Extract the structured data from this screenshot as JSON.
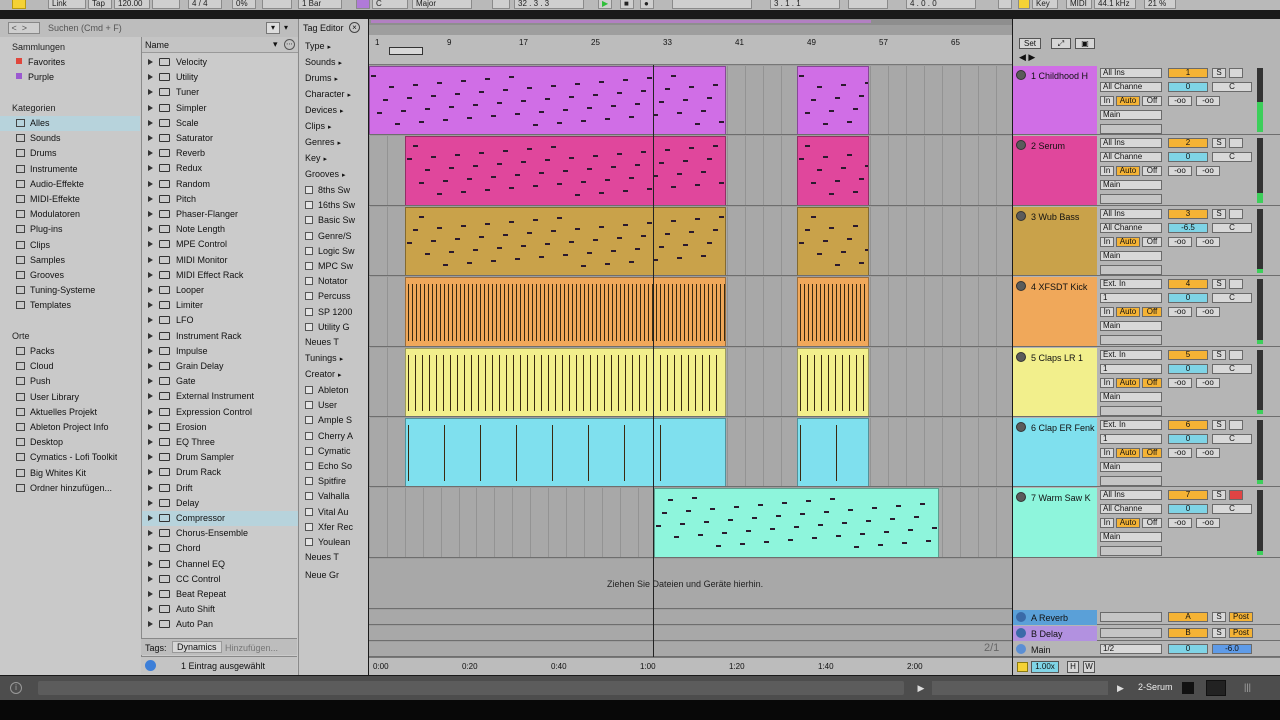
{
  "topbar": {
    "link": "Link",
    "tap": "Tap",
    "tempo": "120.00",
    "signature": "4 / 4",
    "groove_pct": "0%",
    "quantize": "1 Bar",
    "key_root": "C",
    "scale": "Major",
    "position": "32 . 3 . 3",
    "loop_start": "3 . 1 . 1",
    "loop_length": "4 . 0 . 0",
    "key_label": "Key",
    "midi_label": "MIDI",
    "sample_rate": "44.1 kHz",
    "cpu": "21 %"
  },
  "browser": {
    "search_placeholder": "Suchen (Cmd + F)",
    "collections_title": "Sammlungen",
    "collections": [
      {
        "label": "Favorites",
        "color": "#e0463c"
      },
      {
        "label": "Purple",
        "color": "#9b59d0"
      }
    ],
    "categories_title": "Kategorien",
    "categories": [
      "Alles",
      "Sounds",
      "Drums",
      "Instrumente",
      "Audio-Effekte",
      "MIDI-Effekte",
      "Modulatoren",
      "Plug-ins",
      "Clips",
      "Samples",
      "Grooves",
      "Tuning-Systeme",
      "Templates"
    ],
    "places_title": "Orte",
    "places": [
      "Packs",
      "Cloud",
      "Push",
      "User Library",
      "Aktuelles Projekt",
      "Ableton Project Info",
      "Desktop",
      "Cymatics - Lofi Toolkit",
      "Big Whites Kit",
      "Ordner hinzufügen..."
    ],
    "column_name": "Name",
    "items": [
      "Velocity",
      "Utility",
      "Tuner",
      "Simpler",
      "Scale",
      "Saturator",
      "Reverb",
      "Redux",
      "Random",
      "Pitch",
      "Phaser-Flanger",
      "Note Length",
      "MPE Control",
      "MIDI Monitor",
      "MIDI Effect Rack",
      "Looper",
      "Limiter",
      "LFO",
      "Instrument Rack",
      "Impulse",
      "Grain Delay",
      "Gate",
      "External Instrument",
      "Expression Control",
      "Erosion",
      "EQ Three",
      "Drum Sampler",
      "Drum Rack",
      "Drift",
      "Delay",
      "Compressor",
      "Chorus-Ensemble",
      "Chord",
      "Channel EQ",
      "CC Control",
      "Beat Repeat",
      "Auto Shift",
      "Auto Pan"
    ],
    "selected_item": "Compressor",
    "tags_label": "Tags:",
    "tag_dynamics": "Dynamics",
    "tag_add": "Hinzufügen...",
    "status": "1 Eintrag ausgewählt",
    "tag_editor": "Tag Editor",
    "tag_groups": [
      "Type",
      "Sounds",
      "Drums",
      "Character",
      "Devices",
      "Clips",
      "Genres",
      "Key",
      "Grooves"
    ],
    "grooves": [
      "8ths Sw",
      "16ths Sw",
      "Basic Sw",
      "Genre/S",
      "Logic Sw",
      "MPC Sw",
      "Notator",
      "Percuss",
      "SP 1200",
      "Utility G"
    ],
    "new_tag": "Neues T",
    "tunings": "Tunings",
    "creator": "Creator",
    "creators": [
      "Ableton",
      "User",
      "Ample S",
      "Cherry A",
      "Cymatic",
      "Echo So",
      "Spitfire",
      "Valhalla",
      "Vital Au",
      "Xfer Rec",
      "Youlean"
    ],
    "new_tag2": "Neues T",
    "new_group": "Neue Gr"
  },
  "arrangement": {
    "bars": [
      "1",
      "9",
      "17",
      "25",
      "33",
      "41",
      "49",
      "57",
      "65"
    ],
    "times": [
      "0:00",
      "0:20",
      "0:40",
      "1:00",
      "1:20",
      "1:40",
      "2:00"
    ],
    "drop_hint": "Ziehen Sie Dateien und Geräte hierhin.",
    "zoom": "2/1"
  },
  "tracks": [
    {
      "name": "1 Childhood H",
      "color": "#d06ee6",
      "input": "All Ins",
      "channel": "All Channe",
      "num": "1",
      "vol": "0",
      "pan": "C",
      "send_a": "-oo",
      "send_b": "-oo",
      "monitor": "Main"
    },
    {
      "name": "2 Serum",
      "color": "#e0479c",
      "input": "All Ins",
      "channel": "All Channe",
      "num": "2",
      "vol": "0",
      "pan": "C",
      "send_a": "-oo",
      "send_b": "-oo",
      "monitor": "Main"
    },
    {
      "name": "3 Wub Bass",
      "color": "#c9a24a",
      "input": "All Ins",
      "channel": "All Channe",
      "num": "3",
      "vol": "-6.5",
      "pan": "C",
      "send_a": "-oo",
      "send_b": "-oo",
      "monitor": "Main"
    },
    {
      "name": "4 XFSDT Kick",
      "color": "#f0a85a",
      "input": "Ext. In",
      "channel": "1",
      "num": "4",
      "vol": "0",
      "pan": "C",
      "send_a": "-oo",
      "send_b": "-oo",
      "monitor": "Main"
    },
    {
      "name": "5 Claps LR 1",
      "color": "#f2ef8c",
      "input": "Ext. In",
      "channel": "1",
      "num": "5",
      "vol": "0",
      "pan": "C",
      "send_a": "-oo",
      "send_b": "-oo",
      "monitor": "Main"
    },
    {
      "name": "6 Clap ER Fenk",
      "color": "#7fe0ee",
      "input": "Ext. In",
      "channel": "1",
      "num": "6",
      "vol": "0",
      "pan": "C",
      "send_a": "-oo",
      "send_b": "-oo",
      "monitor": "Main"
    },
    {
      "name": "7 Warm Saw K",
      "color": "#8ef5dc",
      "input": "All Ins",
      "channel": "All Channe",
      "num": "7",
      "vol": "0",
      "pan": "C",
      "send_a": "-oo",
      "send_b": "-oo",
      "monitor": "Main"
    }
  ],
  "returns": [
    {
      "name": "A Reverb",
      "letter": "A",
      "post": "Post",
      "color": "#5aa0d8"
    },
    {
      "name": "B Delay",
      "letter": "B",
      "post": "Post",
      "color": "#b291e0"
    }
  ],
  "master": {
    "name": "Main",
    "ratio": "1/2",
    "vol": "0",
    "db": "-6.0",
    "color": "#d478e6"
  },
  "labels": {
    "in": "In",
    "auto": "Auto",
    "off": "Off",
    "s": "S",
    "set": "Set",
    "zoom": "1.00x",
    "h": "H",
    "w": "W"
  },
  "statusbar": {
    "track": "2-Serum"
  },
  "colors": {
    "accent": "#f5d235",
    "playhead": "#222222"
  }
}
